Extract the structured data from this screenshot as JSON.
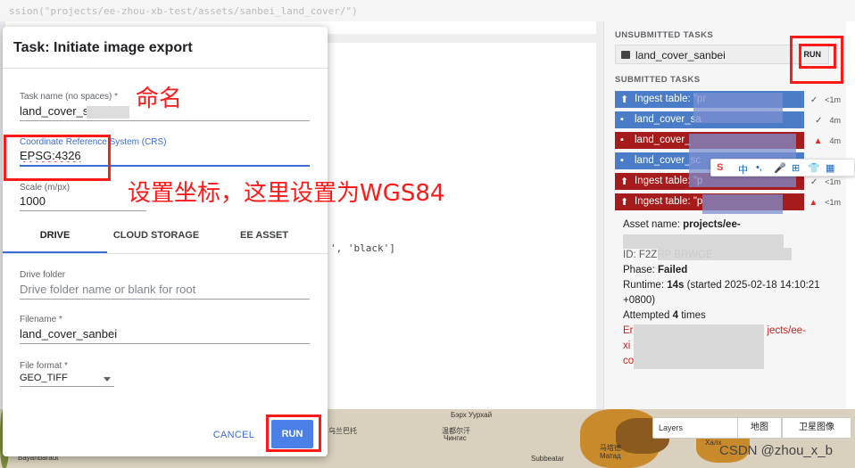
{
  "background": {
    "code_line_top": "ssion(\"projects/ee-zhou-xb-test/assets/sanbei_land_cover/\")",
    "code_line_palette": "', 'black']"
  },
  "task_panel": {
    "unsubmitted_title": "UNSUBMITTED TASKS",
    "unsubmitted_task": {
      "name": "land_cover_sanbei",
      "run_label": "RUN"
    },
    "submitted_title": "SUBMITTED TASKS",
    "tasks": [
      {
        "label": "Ingest table: \"pr",
        "color": "blue",
        "status": "ok",
        "time": "<1m"
      },
      {
        "label": "land_cover_sa",
        "color": "blue",
        "status": "ok",
        "time": "4m"
      },
      {
        "label": "land_cover_",
        "color": "red",
        "status": "failed",
        "time": "4m"
      },
      {
        "label": "land_cover_sc",
        "color": "blue",
        "status": "ok",
        "time": ""
      },
      {
        "label": "Ingest table: \"p",
        "color": "red",
        "status": "ok",
        "time": "<1m"
      },
      {
        "label": "Ingest table: \"p",
        "color": "red",
        "status": "failed",
        "time": "<1m"
      }
    ],
    "details": {
      "asset_name_label": "Asset name:",
      "asset_name_value": "projects/ee-",
      "id_text": "ID: F2ZRP BRWGE",
      "phase_label": "Phase:",
      "phase_value": "Failed",
      "runtime_label": "Runtime:",
      "runtime_value": "14s",
      "runtime_started": "(started 2025-02-18 14:10:21",
      "runtime_tz": "+0800)",
      "attempted_prefix": "Attempted",
      "attempted_count": "4",
      "attempted_suffix": "times",
      "error_line1_start": "Er",
      "error_line1_end": "jects/ee-",
      "error_line2": "xi",
      "error_line3": "co"
    }
  },
  "ime_toolbar": {
    "lang": "中",
    "punct": "•,",
    "mic": "🎤",
    "grid": "⊞",
    "shirt": "👕",
    "apps": "▦"
  },
  "dialog": {
    "title": "Task: Initiate image export",
    "task_name": {
      "label": "Task name (no spaces) *",
      "value": "land_cover_s"
    },
    "crs": {
      "label": "Coordinate Reference System (CRS)",
      "value": "EPSG:4326"
    },
    "scale": {
      "label": "Scale (m/px)",
      "value": "1000"
    },
    "tabs": [
      "DRIVE",
      "CLOUD STORAGE",
      "EE ASSET"
    ],
    "drive_folder": {
      "label": "Drive folder",
      "placeholder": "Drive folder name or blank for root"
    },
    "filename": {
      "label": "Filename *",
      "value": "land_cover_sanbei"
    },
    "file_format": {
      "label": "File format *",
      "value": "GEO_TIFF"
    },
    "cancel_label": "CANCEL",
    "run_label": "RUN"
  },
  "map": {
    "places": [
      "Бэрх Уурхай",
      "温都尔汗",
      "Чингис",
      "乌兰巴托",
      "马塔德",
      "Матад",
      "Халх",
      "Subbeatar",
      "Bayanbaraut"
    ],
    "layers_label": "Layers",
    "map_label": "地图",
    "satellite_label": "卫星图像"
  },
  "annotations": {
    "naming_note": "命名",
    "crs_note": "设置坐标，这里设置为WGS84"
  },
  "watermark": "CSDN @zhou_x_b"
}
